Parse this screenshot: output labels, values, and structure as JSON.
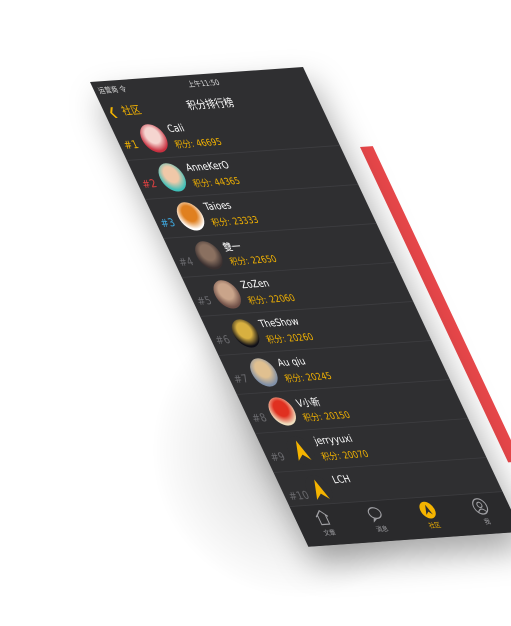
{
  "status": {
    "carrier": "运营商 令",
    "time": "上午11:50"
  },
  "nav": {
    "back_label": "社区",
    "title": "积分排行榜"
  },
  "score_label": "积分:",
  "rows": [
    {
      "rank": "#1",
      "name": "Cali",
      "score": "46695",
      "avatar_colors": [
        "#c83040",
        "#f5d5d0"
      ]
    },
    {
      "rank": "#2",
      "name": "AnneKerO",
      "score": "44365",
      "avatar_colors": [
        "#3fbfb8",
        "#f0c8a8"
      ]
    },
    {
      "rank": "#3",
      "name": "Taioes",
      "score": "23333",
      "avatar_colors": [
        "#ffffff",
        "#e08020"
      ]
    },
    {
      "rank": "#4",
      "name": "雙一",
      "score": "22650",
      "avatar_colors": [
        "#3a3030",
        "#8a7060"
      ]
    },
    {
      "rank": "#5",
      "name": "ZoZen",
      "score": "22060",
      "avatar_colors": [
        "#705048",
        "#c9a48a"
      ]
    },
    {
      "rank": "#6",
      "name": "TheShow",
      "score": "20260",
      "avatar_colors": [
        "#101018",
        "#d8b040"
      ]
    },
    {
      "rank": "#7",
      "name": "Au qiu",
      "score": "20245",
      "avatar_colors": [
        "#8090a8",
        "#e0c090"
      ]
    },
    {
      "rank": "#8",
      "name": "V小新",
      "score": "20150",
      "avatar_colors": [
        "#f0e0c0",
        "#e03020"
      ]
    },
    {
      "rank": "#9",
      "name": "jerryyuxi",
      "score": "20070",
      "avatar_colors": [
        "#2f2f31",
        "#f5b400"
      ]
    },
    {
      "rank": "#10",
      "name": "LCH",
      "score": "",
      "avatar_colors": [
        "#2f2f31",
        "#f5b400"
      ]
    }
  ],
  "tabs": [
    {
      "label": "文章",
      "icon": "home-icon"
    },
    {
      "label": "消息",
      "icon": "chat-icon"
    },
    {
      "label": "社区",
      "icon": "community-icon"
    },
    {
      "label": "我",
      "icon": "profile-icon"
    }
  ],
  "colors": {
    "accent": "#f5b400",
    "rank2": "#e04141",
    "rank3": "#3fa9e0",
    "background": "#2f2f31",
    "edge": "#e8474a"
  }
}
